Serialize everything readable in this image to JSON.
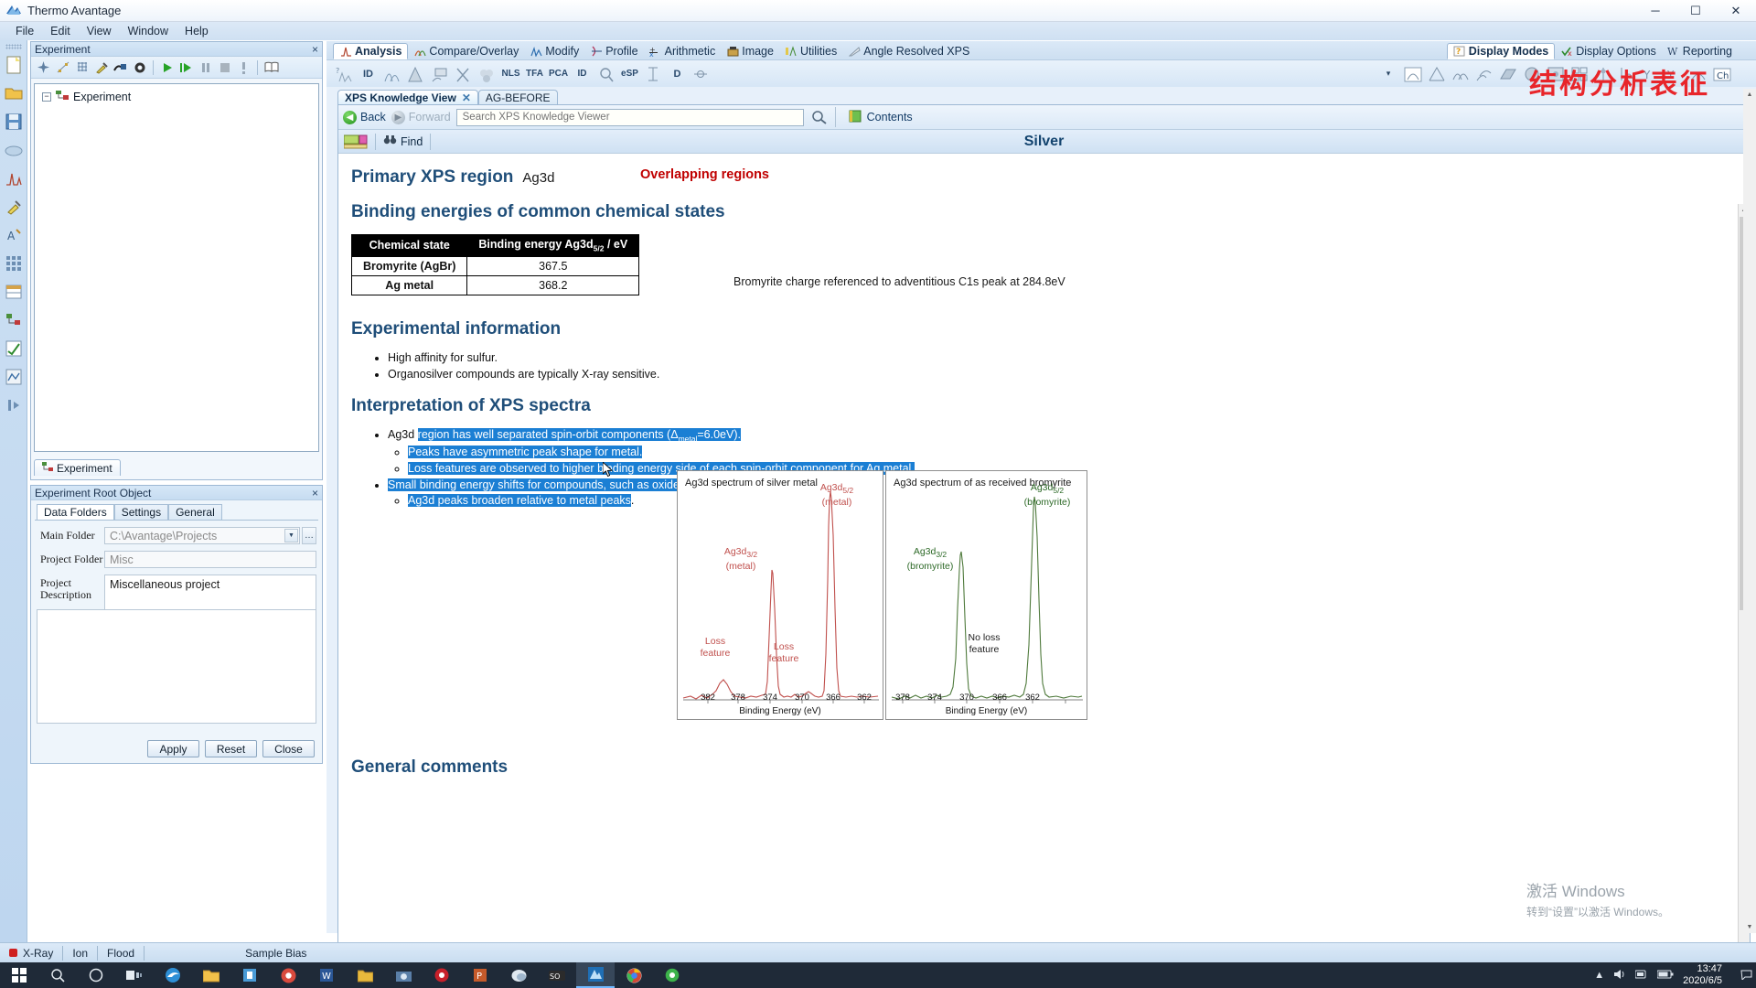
{
  "window": {
    "title": "Thermo Avantage",
    "app_icon": "avantage-logo-icon",
    "minimize": "─",
    "maximize": "☐",
    "close": "✕"
  },
  "menubar": {
    "items": [
      "File",
      "Edit",
      "View",
      "Window",
      "Help"
    ]
  },
  "left_rail": {
    "icons": [
      "new-document-icon",
      "open-folder-icon",
      "save-icon",
      "cloud-icon",
      "spectrum-icon",
      "pipette-icon",
      "annotate-icon",
      "grid-icon",
      "table-icon",
      "tree-icon",
      "check-chart-icon",
      "report-icon",
      "expand-panel-icon"
    ]
  },
  "experiment_panel": {
    "caption": "Experiment",
    "close_glyph": "×",
    "toolbar_icons": [
      "add-icon",
      "point-scan-icon",
      "grid-scan-icon",
      "pipette-icon",
      "stage-icon",
      "settings-gear-icon",
      "run-icon",
      "run-step-icon",
      "pause-icon",
      "stop-icon",
      "alert-icon",
      "book-icon"
    ],
    "tree_root": "Experiment",
    "tree_expander": "−",
    "bottom_tab": "Experiment"
  },
  "root_object_panel": {
    "caption": "Experiment Root Object",
    "close_glyph": "×",
    "tabs": [
      "Data Folders",
      "Settings",
      "General"
    ],
    "active_tab": "Data Folders",
    "fields": [
      {
        "label": "Main Folder",
        "value": "C:\\Avantage\\Projects",
        "type": "combo"
      },
      {
        "label": "Project Folder",
        "value": "Misc",
        "type": "text"
      },
      {
        "label": "Project Description",
        "value": "Miscellaneous project",
        "type": "textarea"
      }
    ],
    "ellipsis_label": "…",
    "buttons": [
      "Apply",
      "Reset",
      "Close"
    ]
  },
  "ribbon": {
    "tabs_left": [
      {
        "label": "Analysis",
        "icon": "peak-chart-icon",
        "active": true
      },
      {
        "label": "Compare/Overlay",
        "icon": "overlay-icon",
        "active": false
      },
      {
        "label": "Modify",
        "icon": "modify-icon",
        "active": false
      },
      {
        "label": "Profile",
        "icon": "profile-icon",
        "active": false
      },
      {
        "label": "Arithmetic",
        "icon": "arithmetic-icon",
        "active": false
      },
      {
        "label": "Image",
        "icon": "image-icon",
        "active": false
      },
      {
        "label": "Utilities",
        "icon": "utilities-icon",
        "active": false
      },
      {
        "label": "Angle Resolved XPS",
        "icon": "arxps-icon",
        "active": false
      }
    ],
    "tabs_right": [
      {
        "label": "Display Modes",
        "icon": "display-modes-icon",
        "active": true
      },
      {
        "label": "Display Options",
        "icon": "display-options-icon",
        "active": false
      },
      {
        "label": "Reporting",
        "icon": "reporting-icon",
        "active": false
      }
    ],
    "tools_left": [
      "quantify-icon",
      "id-icon",
      "peakfit-icon",
      "background-icon",
      "smooth-icon",
      "derivative-icon",
      "cluster-icon",
      "nls-icon",
      "tfa-icon",
      "pca-icon",
      "id2-icon",
      "zoom-icon",
      "esp-icon",
      "range-icon",
      "depth-icon",
      "phi-icon"
    ],
    "tools_left_labels": [
      "",
      "ID",
      "",
      "",
      "",
      "",
      "",
      "NLS",
      "TFA",
      "PCA",
      "ID",
      "",
      "eSP",
      "",
      "D",
      ""
    ],
    "tools_right": [
      "single-display-icon",
      "stack-display-icon",
      "overlay-display-icon",
      "offset-display-icon",
      "3d-display-icon",
      "image-display-icon",
      "map-display-icon",
      "grid-display-icon",
      "marker-display-icon",
      "label-y-icon",
      "label-y2-icon",
      "label-y3-icon",
      "annotate-display-icon",
      "chi-display-icon"
    ],
    "overflow_glyph": "▾"
  },
  "doc_tabs": [
    {
      "label": "XPS Knowledge View",
      "closable": true,
      "close_glyph": "✕",
      "active": true
    },
    {
      "label": "AG-BEFORE",
      "closable": false,
      "active": false
    }
  ],
  "browser": {
    "back_label": "Back",
    "forward_label": "Forward",
    "search_placeholder": "Search XPS Knowledge Viewer",
    "search_value": "",
    "search_icon": "magnifier-icon",
    "contents_label": "Contents",
    "contents_icon": "contents-book-icon",
    "periodic_table_icon": "periodic-table-icon",
    "find_label": "Find",
    "find_icon": "binoculars-icon",
    "element_title": "Silver"
  },
  "document": {
    "primary_label": "Primary XPS region",
    "primary_value": "Ag3d",
    "overlapping_regions": "Overlapping regions",
    "binding_heading": "Binding energies of common chemical states",
    "table": {
      "headers": [
        "Chemical state",
        "Binding energy Ag3d",
        "5/2",
        " / eV"
      ],
      "header_state": "Chemical state",
      "header_energy_pre": "Binding energy Ag3d",
      "header_energy_sub": "5/2",
      "header_energy_post": " / eV",
      "rows": [
        {
          "state": "Bromyrite (AgBr)",
          "energy": "367.5"
        },
        {
          "state": "Ag metal",
          "energy": "368.2"
        }
      ]
    },
    "charge_note": "Bromyrite charge referenced to adventitious C1s peak at 284.8eV",
    "experimental_heading": "Experimental information",
    "experimental_bullets": [
      "High affinity for sulfur.",
      "Organosilver compounds are typically X-ray sensitive."
    ],
    "interpretation_heading": "Interpretation of XPS spectra",
    "interpretation": {
      "b1_plain": "Ag3d ",
      "b1_hl_pre": "region has well separated spin-orbit components (Δ",
      "b1_hl_sub": "metal",
      "b1_hl_post": "=6.0eV).",
      "b1_sub1": "Peaks have asymmetric peak shape for metal.",
      "b1_sub2": "Loss features are observed to higher binding energy side of each spin-orbit component for Ag metal.",
      "b2": "Small binding energy shifts for compounds, such as oxides or halides.",
      "b2_sub1_hl": "Ag3d peaks broaden relative to metal peaks",
      "b2_sub1_tail": "."
    },
    "general_comments_heading": "General comments"
  },
  "chart_data": [
    {
      "type": "line",
      "title": "Ag3d spectrum of silver metal",
      "xlabel": "Binding Energy (eV)",
      "ylabel": "",
      "xlim": [
        384,
        360
      ],
      "xticks": [
        "382",
        "378",
        "374",
        "370",
        "366",
        "362"
      ],
      "color": "#c0504d",
      "annotations": [
        {
          "text": "Ag3d",
          "sub": "3/2",
          "note": "(metal)",
          "x_ev": 374.3
        },
        {
          "text": "Ag3d",
          "sub": "5/2",
          "note": "(metal)",
          "x_ev": 368.2
        },
        {
          "text": "Loss feature",
          "x_ev": 380.5
        },
        {
          "text": "Loss feature",
          "x_ev": 374.0
        }
      ],
      "peaks": [
        {
          "x_ev": 374.3,
          "height": 0.58,
          "label": "Ag3d3/2 (metal)"
        },
        {
          "x_ev": 368.2,
          "height": 1.0,
          "label": "Ag3d5/2 (metal)"
        },
        {
          "x_ev": 380.4,
          "height": 0.1,
          "label": "Loss feature"
        },
        {
          "x_ev": 374.0,
          "height": 0.07,
          "label": "Loss feature"
        }
      ]
    },
    {
      "type": "line",
      "title": "Ag3d spectrum of as received bromyrite",
      "xlabel": "Binding Energy (eV)",
      "ylabel": "",
      "xlim": [
        381,
        360
      ],
      "xticks": [
        "378",
        "374",
        "370",
        "366",
        "362"
      ],
      "color": "#4f7a3c",
      "annotations": [
        {
          "text": "Ag3d",
          "sub": "3/2",
          "note": "(bromyrite)",
          "x_ev": 373.5
        },
        {
          "text": "Ag3d",
          "sub": "5/2",
          "note": "(bromyrite)",
          "x_ev": 367.5
        },
        {
          "text": "No loss feature",
          "x_ev": 371.0
        }
      ],
      "peaks": [
        {
          "x_ev": 373.5,
          "height": 0.62,
          "label": "Ag3d3/2 (bromyrite)"
        },
        {
          "x_ev": 367.5,
          "height": 1.0,
          "label": "Ag3d5/2 (bromyrite)"
        }
      ]
    }
  ],
  "watermark": {
    "chinese_title": "结构分析表征",
    "activate_line1": "激活 Windows",
    "activate_line2": "转到“设置”以激活 Windows。"
  },
  "statusbar": {
    "xray": "X-Ray",
    "ion": "Ion",
    "flood": "Flood",
    "sample_bias": "Sample Bias"
  },
  "taskbar": {
    "start_icon": "windows-start-icon",
    "search_icon": "search-circle-icon",
    "cortana_icon": "cortana-circle-icon",
    "taskview_icon": "task-view-icon",
    "apps": [
      "edge-icon",
      "file-explorer-icon",
      "store-icon",
      "chrome-red-icon",
      "word-icon",
      "folder-yellow-icon",
      "screenshot-icon",
      "netease-icon",
      "powerpoint-icon",
      "wechat-icon",
      "sogou-icon",
      "avantage-icon",
      "chrome-icon",
      "360-icon"
    ],
    "tray": [
      "chevron-up-icon",
      "speaker-icon",
      "network-icon",
      "battery-icon"
    ],
    "time": "13:47",
    "date": "2020/6/5",
    "notification_icon": "notification-icon"
  }
}
